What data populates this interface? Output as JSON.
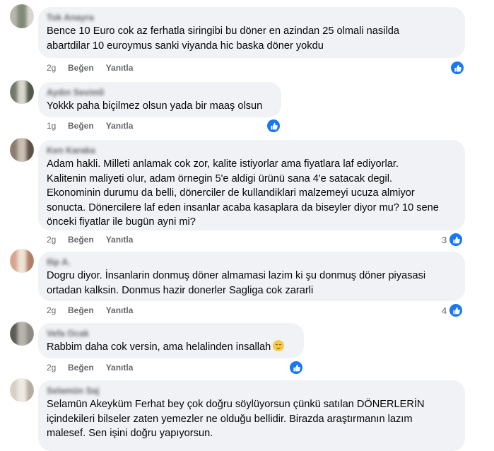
{
  "comments": [
    {
      "author": "Tok Anayra",
      "text": "Bence 10 Euro cok az ferhatla siringibi bu döner en azindan 25 olmali nasilda\nabartdilar 10 euroymus sanki viyanda hic baska döner yokdu",
      "time": "2g",
      "like_label": "Beğen",
      "reply_label": "Yanıtla",
      "reaction_count": "",
      "avatar_colors": [
        "#b9b6ae",
        "#7f8a77",
        "#d9d6cf"
      ]
    },
    {
      "author": "Aydın Sevimli",
      "text": "Yokkk paha biçilmez olsun yada bir maaş olsun",
      "time": "1g",
      "like_label": "Beğen",
      "reply_label": "Yanıtla",
      "reaction_count": "",
      "avatar_colors": [
        "#6f7a6c",
        "#d8d5cd",
        "#4f5a4a"
      ]
    },
    {
      "author": "Ken Karaka",
      "text": "Adam hakli. Milleti anlamak cok zor, kalite istiyorlar ama fiyatlara laf ediyorlar.\nKalitenin maliyeti olur, adam örnegin 5'e aldigi ürünü sana 4'e satacak degil.\nEkonominin durumu da belli, dönerciler de kullandiklari malzemeyi ucuza almiyor\nsonucta. Dönercilere laf eden insanlar acaba kasaplara da biseyler diyor mu? 10 sene\nönceki fiyatlar ile bugün ayni mi?",
      "time": "2g",
      "like_label": "Beğen",
      "reply_label": "Yanıtla",
      "reaction_count": "3",
      "avatar_colors": [
        "#8b7b6e",
        "#c9bfb3",
        "#5e5046"
      ]
    },
    {
      "author": "Ilip A.",
      "text": "Dogru diyor. İnsanlarin donmuş döner almamasi lazim ki şu donmuş döner piyasasi\nortadan kalksin. Donmus hazir donerler Sagliga cok zararli",
      "time": "2g",
      "like_label": "Beğen",
      "reply_label": "Yanıtla",
      "reaction_count": "4",
      "avatar_colors": [
        "#d6a58c",
        "#efe2d6",
        "#b07f66"
      ]
    },
    {
      "author": "Vefa Ocak",
      "text": "Rabbim daha cok versin, ama helalinden insallah",
      "time": "2g",
      "like_label": "Beğen",
      "reply_label": "Yanıtla",
      "reaction_count": "",
      "avatar_colors": [
        "#5b5a56",
        "#b8b4ab",
        "#8d8a83"
      ]
    },
    {
      "author": "Selamün Saj",
      "text": "Selamün Akeyküm Ferhat bey çok doğru söylüyorsun çünkü satılan DÖNERLERİN\niçindekileri bilseler zaten yemezler ne olduğu bellidir. Birazda araştırmanın lazım\nmalesef. Sen işini doğru yapıyorsun.",
      "time": "",
      "like_label": "",
      "reply_label": "",
      "reaction_count": "",
      "avatar_colors": [
        "#d7d0c4",
        "#efebe4",
        "#b6ad9f"
      ]
    }
  ]
}
